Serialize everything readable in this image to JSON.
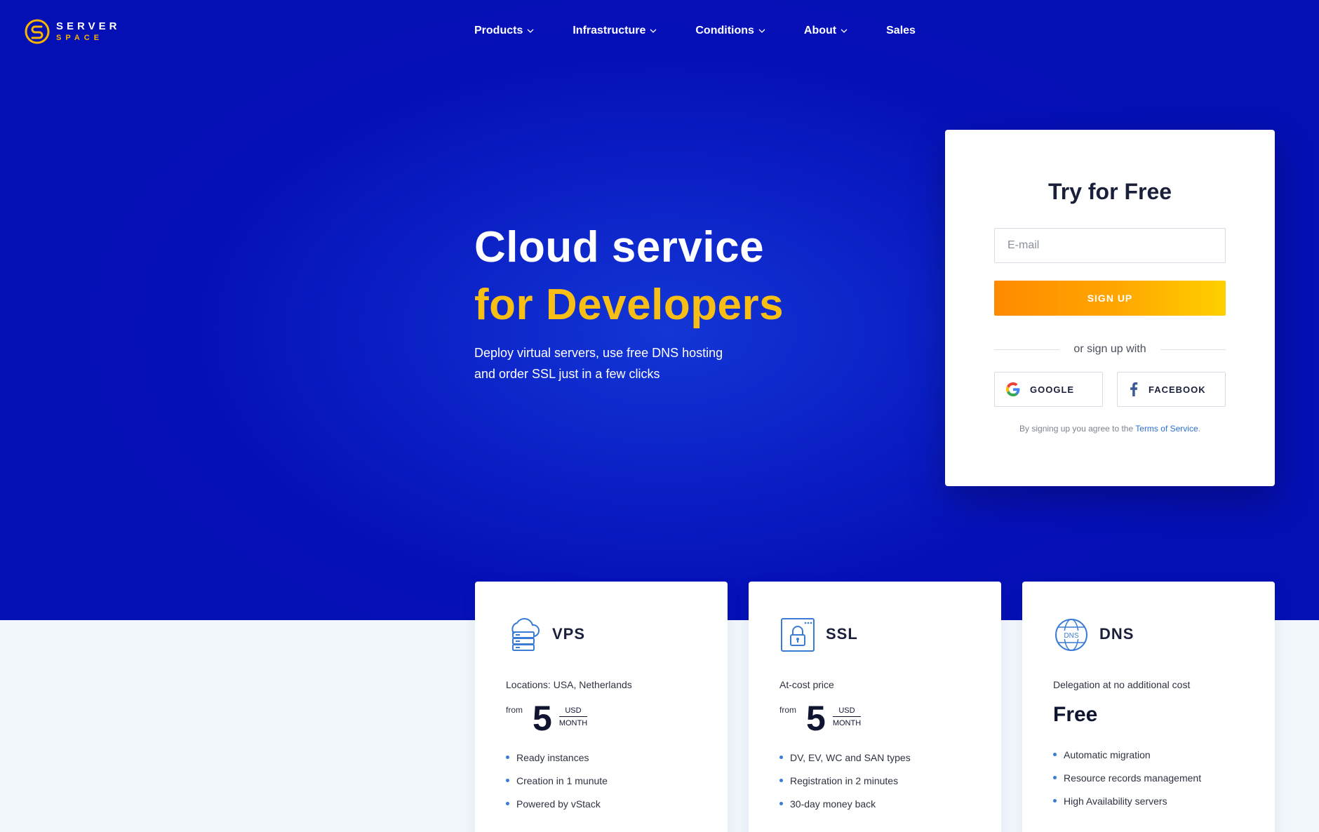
{
  "brand": {
    "top": "SERVER",
    "bottom": "SPACE",
    "accent": "#f7b500",
    "hero_bg": "#0a1ec4"
  },
  "nav": {
    "items": [
      {
        "label": "Products",
        "has_dropdown": true
      },
      {
        "label": "Infrastructure",
        "has_dropdown": true
      },
      {
        "label": "Conditions",
        "has_dropdown": true
      },
      {
        "label": "About",
        "has_dropdown": true
      },
      {
        "label": "Sales",
        "has_dropdown": false
      }
    ]
  },
  "hero": {
    "title_line1": "Cloud service",
    "title_line2": "for Developers",
    "subtitle_line1": "Deploy virtual servers, use free DNS hosting",
    "subtitle_line2": "and order SSL just in a few clicks"
  },
  "signup": {
    "title": "Try for Free",
    "email_placeholder": "E-mail",
    "button_label": "SIGN UP",
    "or_text": "or sign up with",
    "google_label": "GOOGLE",
    "facebook_label": "FACEBOOK",
    "terms_prefix": "By signing up you agree to the ",
    "terms_link": "Terms of Service",
    "terms_suffix": "."
  },
  "products": [
    {
      "icon": "cloud-server-icon",
      "title": "VPS",
      "desc": "Locations: USA, Netherlands",
      "price_from": "from",
      "price_value": "5",
      "price_currency": "USD",
      "price_period": "MONTH",
      "features": [
        "Ready instances",
        "Creation in 1 munute",
        "Powered by vStack"
      ]
    },
    {
      "icon": "ssl-lock-icon",
      "title": "SSL",
      "desc": "At-cost price",
      "price_from": "from",
      "price_value": "5",
      "price_currency": "USD",
      "price_period": "MONTH",
      "features": [
        "DV, EV, WC and SAN types",
        "Registration in 2 minutes",
        "30-day money back"
      ]
    },
    {
      "icon": "dns-globe-icon",
      "title": "DNS",
      "desc": "Delegation at no additional cost",
      "price_text": "Free",
      "features": [
        "Automatic migration",
        "Resource records management",
        "High Availability servers"
      ]
    }
  ]
}
